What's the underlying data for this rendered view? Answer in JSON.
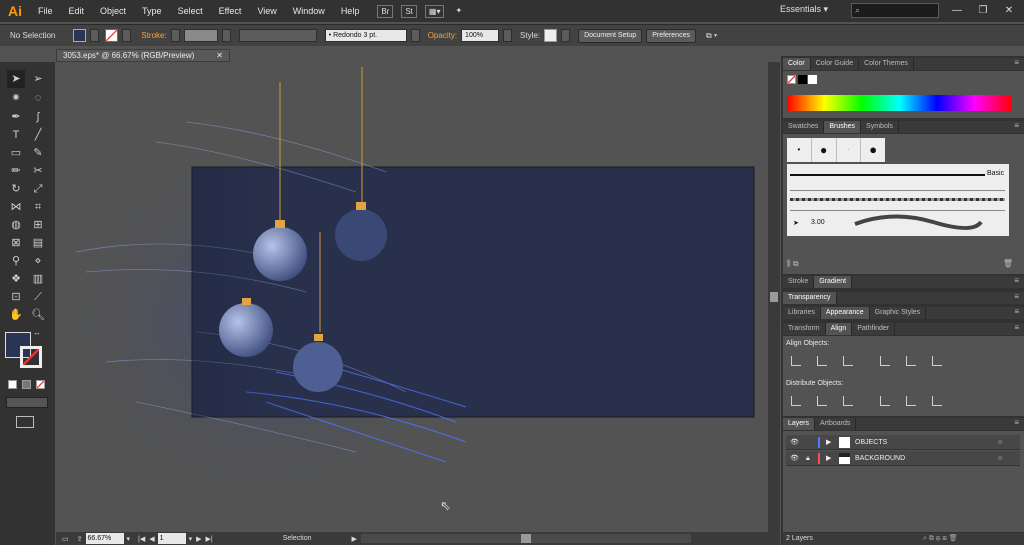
{
  "app": {
    "logo": "Ai"
  },
  "menu": [
    "File",
    "Edit",
    "Object",
    "Type",
    "Select",
    "Effect",
    "View",
    "Window",
    "Help"
  ],
  "menubar_icons": [
    "br-icon",
    "St",
    "▦▾",
    "✦"
  ],
  "workspace": "Essentials",
  "search_placeholder": "",
  "window_buttons": [
    "—",
    "❐",
    "✕"
  ],
  "control": {
    "selection": "No Selection",
    "stroke_label": "Stroke:",
    "brush": "Redondo 3 pt.",
    "opacity_label": "Opacity:",
    "opacity_value": "100%",
    "style_label": "Style:",
    "document_setup": "Document Setup",
    "preferences": "Preferences"
  },
  "document": {
    "tab_title": "3053.eps* @ 66.67% (RGB/Preview)",
    "close": "✕"
  },
  "status": {
    "zoom": "66.67%",
    "page": "1",
    "tool": "Selection"
  },
  "panels": {
    "color_tabs": [
      "Color",
      "Color Guide",
      "Color Themes"
    ],
    "brush_tabs": [
      "Swatches",
      "Brushes",
      "Symbols"
    ],
    "brush_basic": "Basic",
    "brush_size": "3.00",
    "stroke_tabs": [
      "Stroke",
      "Gradient"
    ],
    "transparency_tab": "Transparency",
    "appearance_tabs": [
      "Libraries",
      "Appearance",
      "Graphic Styles"
    ],
    "align_tabs": [
      "Transform",
      "Align",
      "Pathfinder"
    ],
    "align_objects": "Align Objects:",
    "distribute_objects": "Distribute Objects:",
    "layers_tabs": [
      "Layers",
      "Artboards"
    ],
    "layers": [
      {
        "name": "OBJECTS",
        "color": "#4f7bff",
        "locked": false
      },
      {
        "name": "BACKGROUND",
        "color": "#ff4b4b",
        "locked": true
      }
    ],
    "layers_count": "2 Layers"
  },
  "colors": {
    "artboard": "#28304b",
    "accent": "#f7a531"
  }
}
